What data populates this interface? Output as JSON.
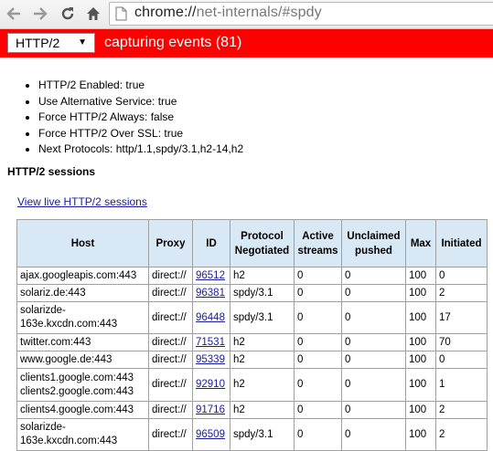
{
  "browser": {
    "url_scheme": "chrome://",
    "url_rest": "net-internals/#spdy",
    "back_icon": "back-arrow-icon",
    "forward_icon": "forward-arrow-icon",
    "reload_icon": "reload-icon",
    "home_icon": "home-icon",
    "page_icon": "page-icon"
  },
  "statusbar": {
    "selected_view": "HTTP/2",
    "capture_text": "capturing events (81)",
    "color": "#ff0000"
  },
  "status_items": [
    "HTTP/2 Enabled: true",
    "Use Alternative Service: true",
    "Force HTTP/2 Always: false",
    "Force HTTP/2 Over SSL: true",
    "Next Protocols: http/1.1,spdy/3.1,h2-14,h2"
  ],
  "sessions_title": "HTTP/2 sessions",
  "live_link": "View live HTTP/2 sessions",
  "table": {
    "headers": [
      "Host",
      "Proxy",
      "ID",
      "Protocol Negotiated",
      "Active streams",
      "Unclaimed pushed",
      "Max",
      "Initiated"
    ],
    "rows": [
      {
        "host": "ajax.googleapis.com:443",
        "proxy": "direct://",
        "id": "96512",
        "protocol": "h2",
        "active": "0",
        "unclaimed": "0",
        "max": "100",
        "initiated": "0"
      },
      {
        "host": "solariz.de:443",
        "proxy": "direct://",
        "id": "96381",
        "protocol": "spdy/3.1",
        "active": "0",
        "unclaimed": "0",
        "max": "100",
        "initiated": "2"
      },
      {
        "host": "solarizde-163e.kxcdn.com:443",
        "proxy": "direct://",
        "id": "96448",
        "protocol": "spdy/3.1",
        "active": "0",
        "unclaimed": "0",
        "max": "100",
        "initiated": "17"
      },
      {
        "host": "twitter.com:443",
        "proxy": "direct://",
        "id": "71531",
        "protocol": "h2",
        "active": "0",
        "unclaimed": "0",
        "max": "100",
        "initiated": "70"
      },
      {
        "host": "www.google.de:443",
        "proxy": "direct://",
        "id": "95339",
        "protocol": "h2",
        "active": "0",
        "unclaimed": "0",
        "max": "100",
        "initiated": "0"
      },
      {
        "host": "clients1.google.com:443 clients2.google.com:443",
        "proxy": "direct://",
        "id": "92910",
        "protocol": "h2",
        "active": "0",
        "unclaimed": "0",
        "max": "100",
        "initiated": "1"
      },
      {
        "host": "clients4.google.com:443",
        "proxy": "direct://",
        "id": "91716",
        "protocol": "h2",
        "active": "0",
        "unclaimed": "0",
        "max": "100",
        "initiated": "2"
      },
      {
        "host": "solarizde-163e.kxcdn.com:443",
        "proxy": "direct://",
        "id": "96509",
        "protocol": "spdy/3.1",
        "active": "0",
        "unclaimed": "0",
        "max": "100",
        "initiated": "2"
      }
    ]
  }
}
